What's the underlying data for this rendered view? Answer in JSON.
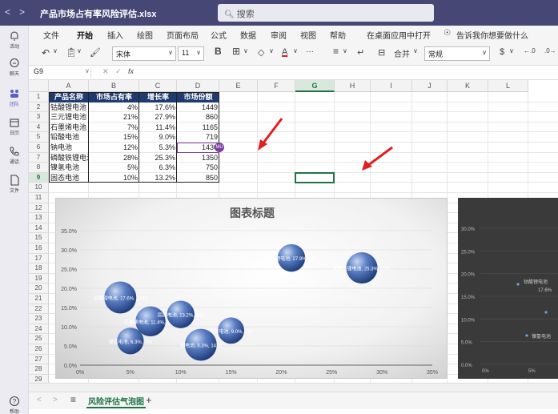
{
  "titlebar": {
    "back": "<",
    "forward": ">",
    "file_title": "产品市场占有率风险评估.xlsx",
    "search_placeholder": "搜索"
  },
  "leftrail": [
    {
      "label": "活动",
      "icon": "bell-icon"
    },
    {
      "label": "聊天",
      "icon": "chat-icon"
    },
    {
      "label": "团队",
      "icon": "teams-icon",
      "active": true
    },
    {
      "label": "日历",
      "icon": "calendar-icon"
    },
    {
      "label": "通话",
      "icon": "phone-icon"
    },
    {
      "label": "文件",
      "icon": "file-icon"
    },
    {
      "label": "帮助",
      "icon": "help-icon"
    }
  ],
  "ribbon": {
    "tabs": [
      "文件",
      "开始",
      "插入",
      "绘图",
      "页面布局",
      "公式",
      "数据",
      "审阅",
      "视图",
      "帮助",
      "在桌面应用中打开",
      "告诉我你想要做什么"
    ],
    "active_tab": "开始",
    "font_name": "宋体",
    "font_size": "11",
    "bold": "B",
    "merge": "合并",
    "number_format": "常规",
    "currency": "$",
    "more": "···"
  },
  "formulabar": {
    "name_box": "G9",
    "fx": "fx",
    "content": ""
  },
  "grid": {
    "columns": [
      "A",
      "B",
      "C",
      "D",
      "E",
      "F",
      "G",
      "H",
      "I",
      "J",
      "K",
      "L"
    ],
    "selected_column": "G",
    "rows": [
      "1",
      "2",
      "3",
      "4",
      "5",
      "6",
      "7",
      "8",
      "9",
      "10",
      "11",
      "12",
      "13",
      "14",
      "15",
      "16",
      "17",
      "18",
      "19",
      "20",
      "21",
      "22",
      "23",
      "24",
      "25",
      "26",
      "27",
      "28",
      "29"
    ],
    "selected_row": "9",
    "selected_cell": "G9"
  },
  "table": {
    "headers": [
      "产品名称",
      "市场占有率",
      "增长率",
      "市场份额"
    ],
    "rows": [
      [
        "钴酸锂电池",
        "4%",
        "17.6%",
        "1449"
      ],
      [
        "三元锂电池",
        "21%",
        "27.9%",
        "860"
      ],
      [
        "石墨烯电池",
        "7%",
        "11.4%",
        "1165"
      ],
      [
        "铅酸电池",
        "15%",
        "9.0%",
        "719"
      ],
      [
        "钠电池",
        "12%",
        "5.3%",
        "1430"
      ],
      [
        "磷酸铁锂电池",
        "28%",
        "25.3%",
        "1350"
      ],
      [
        "镍氢电池",
        "5%",
        "6.3%",
        "750"
      ],
      [
        "固态电池",
        "10%",
        "13.2%",
        "850"
      ]
    ]
  },
  "presence_badge": "MU",
  "chart_data": {
    "type": "scatter",
    "title": "图表标题",
    "xlim": [
      0,
      35
    ],
    "ylim": [
      0,
      35
    ],
    "x_ticks": [
      "0%",
      "5%",
      "10%",
      "15%",
      "20%",
      "25%",
      "30%",
      "35%"
    ],
    "y_ticks": [
      "0.0%",
      "5.0%",
      "10.0%",
      "15.0%",
      "20.0%",
      "25.0%",
      "30.0%",
      "35.0%"
    ],
    "points": [
      {
        "name": "钴酸锂电池",
        "x": 4,
        "y": 17.6,
        "size": 1449,
        "label": "钴酸锂电池, 17.6%, 1449"
      },
      {
        "name": "三元锂电池",
        "x": 21,
        "y": 27.9,
        "size": 860,
        "label": "三元锂电池, 27.9%, 860"
      },
      {
        "name": "石墨烯电池",
        "x": 7,
        "y": 11.4,
        "size": 1165,
        "label": "石墨烯电池, 11.4%, 1165"
      },
      {
        "name": "铅酸电池",
        "x": 15,
        "y": 9.0,
        "size": 719,
        "label": "铅酸电池, 9.0%, 719"
      },
      {
        "name": "钠电池",
        "x": 12,
        "y": 5.3,
        "size": 1430,
        "label": "钠电池, 5.3%, 1430"
      },
      {
        "name": "磷酸铁锂电池",
        "x": 28,
        "y": 25.3,
        "size": 1350,
        "label": "磷酸铁锂电池, 25.3%, 1350"
      },
      {
        "name": "镍氢电池",
        "x": 5,
        "y": 6.3,
        "size": 750,
        "label": "镍氢电池, 6.3%, 750"
      },
      {
        "name": "固态电池",
        "x": 10,
        "y": 13.2,
        "size": 850,
        "label": "固态电池, 13.2%, 850"
      }
    ],
    "bubble_color": "#4a6fb5",
    "grid": true
  },
  "second_chart": {
    "y_ticks": [
      "0.0%",
      "5.0%",
      "10.0%",
      "15.0%",
      "20.0%",
      "25.0%",
      "30.0%"
    ],
    "x_ticks": [
      "0%",
      "5%"
    ],
    "labels": [
      "钴酸锂电池",
      "17.6%",
      "镍氢电池"
    ]
  },
  "sheetbar": {
    "menu": "≡",
    "sheet_name": "风险评估气泡图",
    "add": "+"
  },
  "accent_colors": {
    "title_bar": "#464775",
    "excel_green": "#217346",
    "table_header": "#1f3a6e",
    "arrow_red": "#e02020"
  }
}
